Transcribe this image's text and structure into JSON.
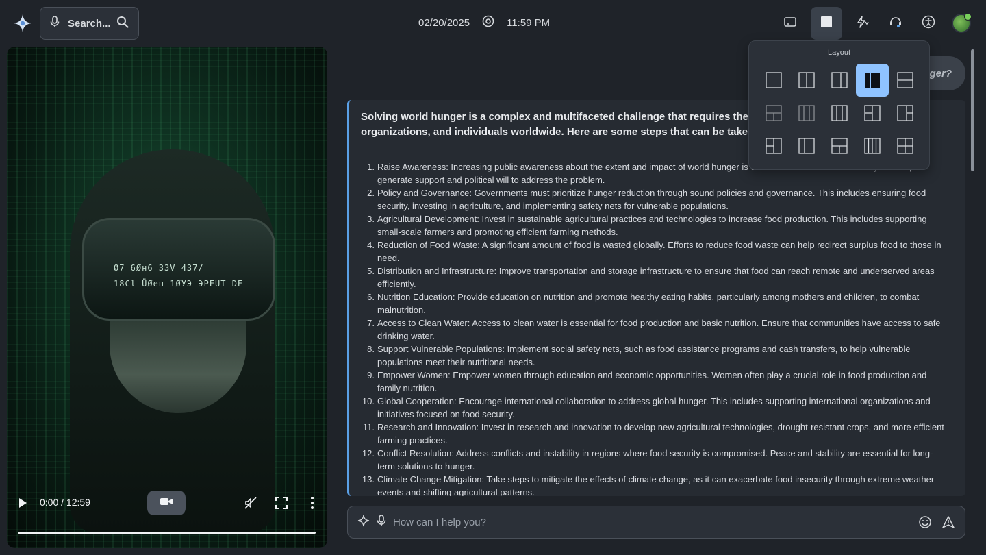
{
  "header": {
    "search_label": "Search...",
    "date": "02/20/2025",
    "time": "11:59 PM"
  },
  "video": {
    "time": "0:00 / 12:59",
    "visor_lines": [
      "Ø7   6Øн6   ЗЗV   4З7/",
      "18Cl  ÜØeн   1ØУЭ  ЭРЕUТ DE"
    ]
  },
  "chat": {
    "user_bubble": "ger?",
    "intro": "Solving world hunger is a complex and multifaceted challenge that requires the coordinated efforts of governments, organizations, and individuals worldwide. Here are some steps that can be taken to address world hunger:",
    "items": [
      {
        "num": "1.",
        "text": "Raise Awareness: Increasing public awareness about the extent and impact of world hunger is crucial. Education and advocacy can help generate support and political will to address the problem."
      },
      {
        "num": "2.",
        "text": "Policy and Governance: Governments must prioritize hunger reduction through sound policies and governance. This includes ensuring food security, investing in agriculture, and implementing safety nets for vulnerable populations."
      },
      {
        "num": "3.",
        "text": "Agricultural Development: Invest in sustainable agricultural practices and technologies to increase food production. This includes supporting small-scale farmers and promoting efficient farming methods."
      },
      {
        "num": "4.",
        "text": "Reduction of Food Waste: A significant amount of food is wasted globally. Efforts to reduce food waste can help redirect surplus food to those in need."
      },
      {
        "num": "5.",
        "text": "Distribution and Infrastructure: Improve transportation and storage infrastructure to ensure that food can reach remote and underserved areas efficiently."
      },
      {
        "num": "6.",
        "text": "Nutrition Education: Provide education on nutrition and promote healthy eating habits, particularly among mothers and children, to combat malnutrition."
      },
      {
        "num": "7.",
        "text": "Access to Clean Water: Access to clean water is essential for food production and basic nutrition. Ensure that communities have access to safe drinking water."
      },
      {
        "num": "8.",
        "text": "Support Vulnerable Populations: Implement social safety nets, such as food assistance programs and cash transfers, to help vulnerable populations meet their nutritional needs."
      },
      {
        "num": "9.",
        "text": "Empower Women: Empower women through education and economic opportunities. Women often play a crucial role in food production and family nutrition."
      },
      {
        "num": "10.",
        "text": "Global Cooperation: Encourage international collaboration to address global hunger. This includes supporting international organizations and initiatives focused on food security."
      },
      {
        "num": "11.",
        "text": "Research and Innovation: Invest in research and innovation to develop new agricultural technologies, drought-resistant crops, and more efficient farming practices."
      },
      {
        "num": "12.",
        "text": "Conflict Resolution: Address conflicts and instability in regions where food security is compromised. Peace and stability are essential for long-term solutions to hunger."
      },
      {
        "num": "13.",
        "text": "Climate Change Mitigation: Take steps to mitigate the effects of climate change, as it can exacerbate food insecurity through extreme weather events and shifting agricultural patterns."
      }
    ]
  },
  "composer": {
    "placeholder": "How can I help you?"
  },
  "layout_menu": {
    "title": "Layout",
    "selected_index": 3,
    "accent": "#8fc3ff"
  },
  "colors": {
    "background": "#1f2329",
    "panel": "#262b32",
    "accent_border": "#5aa0e6"
  }
}
